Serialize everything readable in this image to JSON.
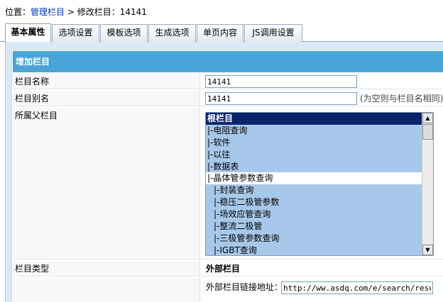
{
  "breadcrumb": {
    "prefix": "位置：",
    "link": "管理栏目",
    "separator": " > ",
    "current": "修改栏目：14141"
  },
  "tabs": [
    {
      "label": "基本属性",
      "active": true
    },
    {
      "label": "选项设置",
      "active": false
    },
    {
      "label": "模板选项",
      "active": false
    },
    {
      "label": "生成选项",
      "active": false
    },
    {
      "label": "单页内容",
      "active": false
    },
    {
      "label": "JS调用设置",
      "active": false
    }
  ],
  "form": {
    "section_title": "增加栏目",
    "name_label": "栏目名称",
    "name_value": "14141",
    "alias_label": "栏目别名",
    "alias_value": "14141",
    "alias_hint": "(为空则与栏目名相同)",
    "parent_label": "所属父栏目",
    "parent_options": [
      {
        "label": "根栏目",
        "state": "selected"
      },
      {
        "label": "|-电阻查询"
      },
      {
        "label": "|-软件"
      },
      {
        "label": "|-以往"
      },
      {
        "label": "|-数据表"
      },
      {
        "label": "|-晶体管参数查询",
        "state": "white"
      },
      {
        "label": "|-封装查询",
        "child": true
      },
      {
        "label": "|-稳压二极管参数",
        "child": true
      },
      {
        "label": "|-场效应管查询",
        "child": true
      },
      {
        "label": "|-整流二极管",
        "child": true
      },
      {
        "label": "|-三极管参数查询",
        "child": true
      },
      {
        "label": "|-IGBT查询",
        "child": true
      }
    ],
    "type_label": "栏目类型",
    "type_value": "外部栏目",
    "external_link_label": "外部栏目链接地址：",
    "external_link_value": "http://ww.asdq.com/e/search/result/?"
  }
}
